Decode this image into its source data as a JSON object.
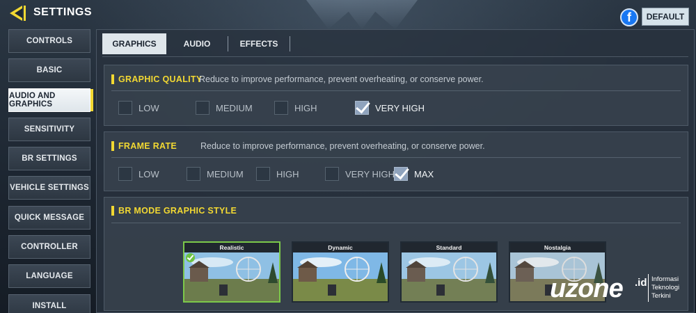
{
  "header": {
    "title": "SETTINGS",
    "default_label": "DEFAULT",
    "facebook_glyph": "f"
  },
  "sidebar": {
    "items": [
      {
        "label": "CONTROLS",
        "active": false
      },
      {
        "label": "BASIC",
        "active": false
      },
      {
        "label": "AUDIO AND GRAPHICS",
        "active": true
      },
      {
        "label": "SENSITIVITY",
        "active": false
      },
      {
        "label": "BR SETTINGS",
        "active": false
      },
      {
        "label": "VEHICLE SETTINGS",
        "active": false
      },
      {
        "label": "QUICK MESSAGE",
        "active": false
      },
      {
        "label": "CONTROLLER",
        "active": false
      },
      {
        "label": "LANGUAGE",
        "active": false
      },
      {
        "label": "INSTALL",
        "active": false
      }
    ]
  },
  "tabs": [
    {
      "label": "GRAPHICS",
      "active": true
    },
    {
      "label": "AUDIO",
      "active": false
    },
    {
      "label": "EFFECTS",
      "active": false
    }
  ],
  "graphic_quality": {
    "title": "GRAPHIC QUALITY",
    "description": "Reduce to improve performance, prevent overheating, or conserve power.",
    "options": [
      {
        "label": "LOW",
        "checked": false
      },
      {
        "label": "MEDIUM",
        "checked": false
      },
      {
        "label": "HIGH",
        "checked": false
      },
      {
        "label": "VERY HIGH",
        "checked": true
      }
    ]
  },
  "frame_rate": {
    "title": "FRAME RATE",
    "description": "Reduce to improve performance, prevent overheating, or conserve power.",
    "options": [
      {
        "label": "LOW",
        "checked": false
      },
      {
        "label": "MEDIUM",
        "checked": false
      },
      {
        "label": "HIGH",
        "checked": false
      },
      {
        "label": "VERY HIGH",
        "checked": false
      },
      {
        "label": "MAX",
        "checked": true
      }
    ]
  },
  "br_mode_style": {
    "title": "BR MODE GRAPHIC STYLE",
    "cards": [
      {
        "label": "Realistic",
        "selected": true
      },
      {
        "label": "Dynamic",
        "selected": false
      },
      {
        "label": "Standard",
        "selected": false
      },
      {
        "label": "Nostalgia",
        "selected": false
      }
    ]
  },
  "watermark": {
    "logo": "uzone",
    "suffix": ".id",
    "tagline_1": "Informasi",
    "tagline_2": "Teknologi",
    "tagline_3": "Terkini"
  },
  "colors": {
    "accent_yellow": "#f2d832",
    "selected_green": "#7cc94a",
    "facebook_blue": "#1877f2"
  }
}
